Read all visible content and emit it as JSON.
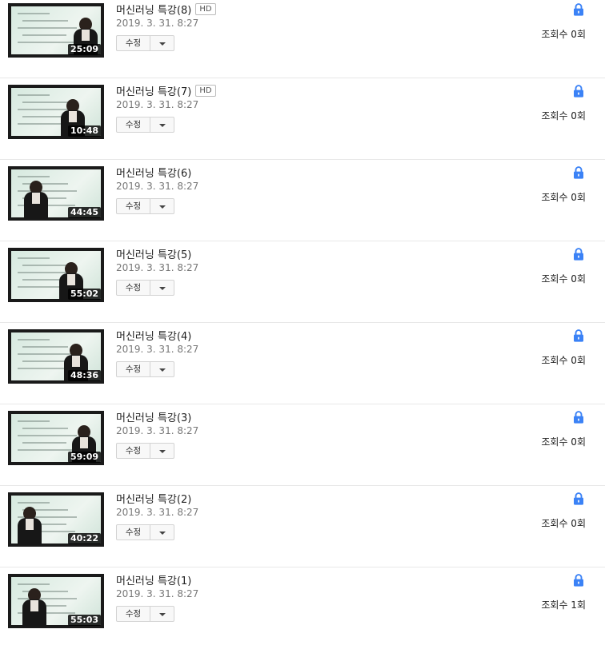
{
  "edit_label": "수정",
  "hd_label": "HD",
  "lock_icon_color": "#3b82f6",
  "videos": [
    {
      "title": "머신러닝 특강(8)",
      "hd": true,
      "date": "2019. 3. 31. 8:27",
      "duration": "25:09",
      "views": "조회수 0회"
    },
    {
      "title": "머신러닝 특강(7)",
      "hd": true,
      "date": "2019. 3. 31. 8:27",
      "duration": "10:48",
      "views": "조회수 0회"
    },
    {
      "title": "머신러닝 특강(6)",
      "hd": false,
      "date": "2019. 3. 31. 8:27",
      "duration": "44:45",
      "views": "조회수 0회"
    },
    {
      "title": "머신러닝 특강(5)",
      "hd": false,
      "date": "2019. 3. 31. 8:27",
      "duration": "55:02",
      "views": "조회수 0회"
    },
    {
      "title": "머신러닝 특강(4)",
      "hd": false,
      "date": "2019. 3. 31. 8:27",
      "duration": "48:36",
      "views": "조회수 0회"
    },
    {
      "title": "머신러닝 특강(3)",
      "hd": false,
      "date": "2019. 3. 31. 8:27",
      "duration": "59:09",
      "views": "조회수 0회"
    },
    {
      "title": "머신러닝 특강(2)",
      "hd": false,
      "date": "2019. 3. 31. 8:27",
      "duration": "40:22",
      "views": "조회수 0회"
    },
    {
      "title": "머신러닝 특강(1)",
      "hd": false,
      "date": "2019. 3. 31. 8:27",
      "duration": "55:03",
      "views": "조회수 1회"
    }
  ]
}
